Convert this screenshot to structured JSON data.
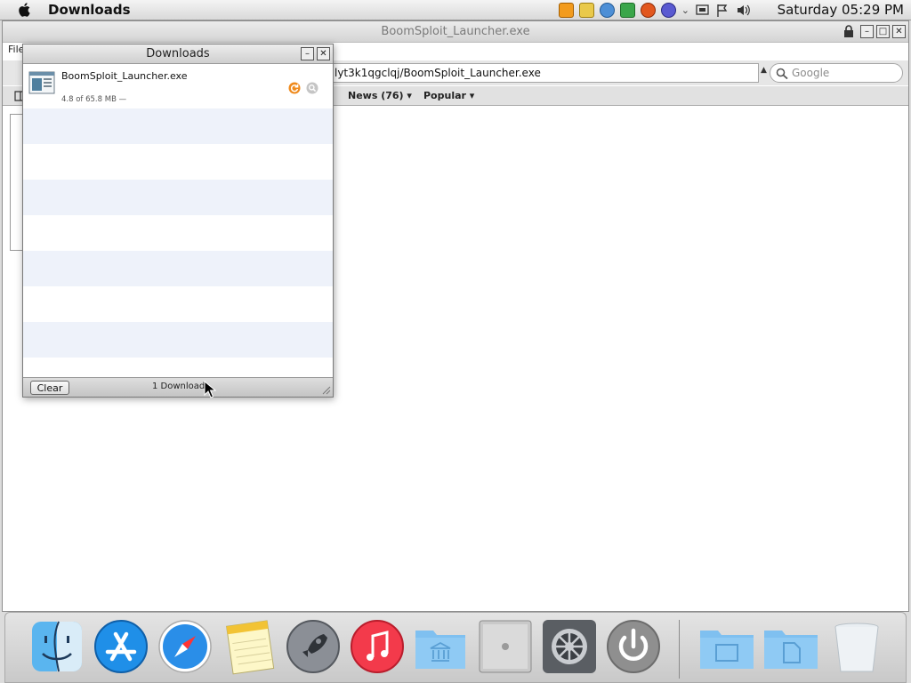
{
  "menubar": {
    "app_name": "Downloads",
    "clock": "Saturday 05:29 PM"
  },
  "browser": {
    "title": "BoomSploit_Launcher.exe",
    "menu_partial": "File",
    "address_value": "lyt3k1qgclqj/BoomSploit_Launcher.exe",
    "search_placeholder": "Google",
    "bookmarks": {
      "news": "News (76) ▾",
      "popular": "Popular ▾"
    }
  },
  "downloads": {
    "title": "Downloads",
    "items": [
      {
        "name": "BoomSploit_Launcher.exe",
        "progress": "4.8 of 65.8 MB —"
      }
    ],
    "clear_label": "Clear",
    "count_label": "1 Download"
  },
  "dock": {
    "apps": [
      "finder",
      "app-store",
      "safari",
      "notes",
      "launchpad",
      "itunes",
      "applications-folder",
      "mac-pro",
      "system-preferences",
      "shutdown",
      "documents-folder",
      "downloads-folder",
      "trash"
    ]
  },
  "colors": {
    "accent": "#1f8fe8",
    "stripe": "#eef2fa"
  }
}
